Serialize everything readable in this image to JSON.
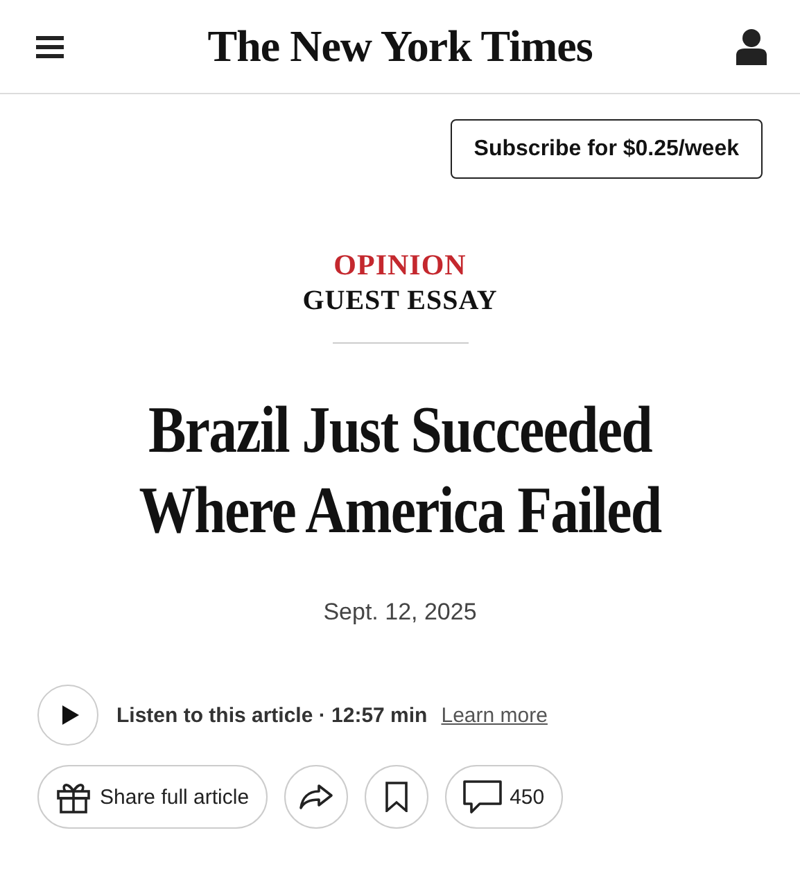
{
  "header": {
    "logo": "The New York Times"
  },
  "subscribe": {
    "label": "Subscribe for $0.25/week"
  },
  "article": {
    "section": "OPINION",
    "kicker": "GUEST ESSAY",
    "headline": [
      "Brazil Just Succeeded",
      "Where America Failed"
    ],
    "date": "Sept. 12, 2025"
  },
  "audio": {
    "label": "Listen to this article · 12:57 min",
    "link": "Learn more"
  },
  "actions": {
    "share": "Share full article",
    "comments": "450"
  }
}
